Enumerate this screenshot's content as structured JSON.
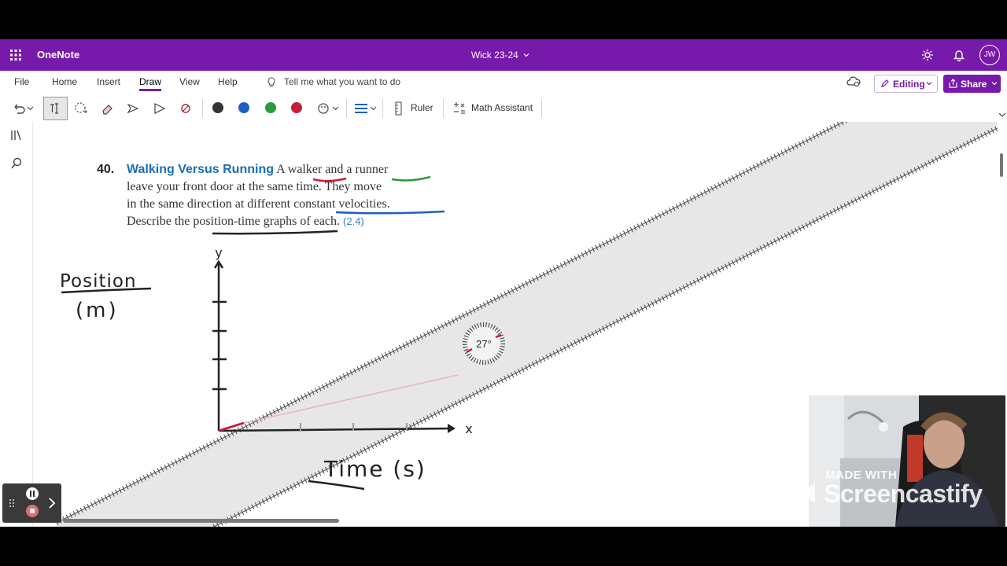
{
  "app": {
    "name": "OneNote",
    "notebook_title": "Wick 23-24",
    "user_initials": "JW"
  },
  "menu": {
    "tabs": [
      {
        "label": "File"
      },
      {
        "label": "Home"
      },
      {
        "label": "Insert"
      },
      {
        "label": "Draw"
      },
      {
        "label": "View"
      },
      {
        "label": "Help"
      }
    ],
    "active_tab": "Draw",
    "tell_me": "Tell me what you want to do",
    "editing_label": "Editing",
    "share_label": "Share"
  },
  "toolbar": {
    "ruler_label": "Ruler",
    "math_label": "Math Assistant",
    "pen_colors": [
      "#333333",
      "#1f5fbf",
      "#2a9c3a",
      "#c4203a"
    ],
    "accent": "#7719aa"
  },
  "problem": {
    "number": "40.",
    "title": "Walking Versus Running",
    "line1_rest": " A walker and a runner",
    "line2": "leave your front door at the same time. They move",
    "line3": "in the same direction at different constant velocities.",
    "line4_text": "Describe the position-time graphs of each.",
    "line4_ref": "(2.4)"
  },
  "handwriting": {
    "y_axis_label": "Position",
    "y_unit": "(m)",
    "x_axis_label": "Time (s)",
    "y_letter": "y",
    "x_letter": "x"
  },
  "ruler": {
    "angle_readout": "27°"
  },
  "watermark": {
    "made_with": "MADE WITH",
    "brand": "Screencastify"
  }
}
